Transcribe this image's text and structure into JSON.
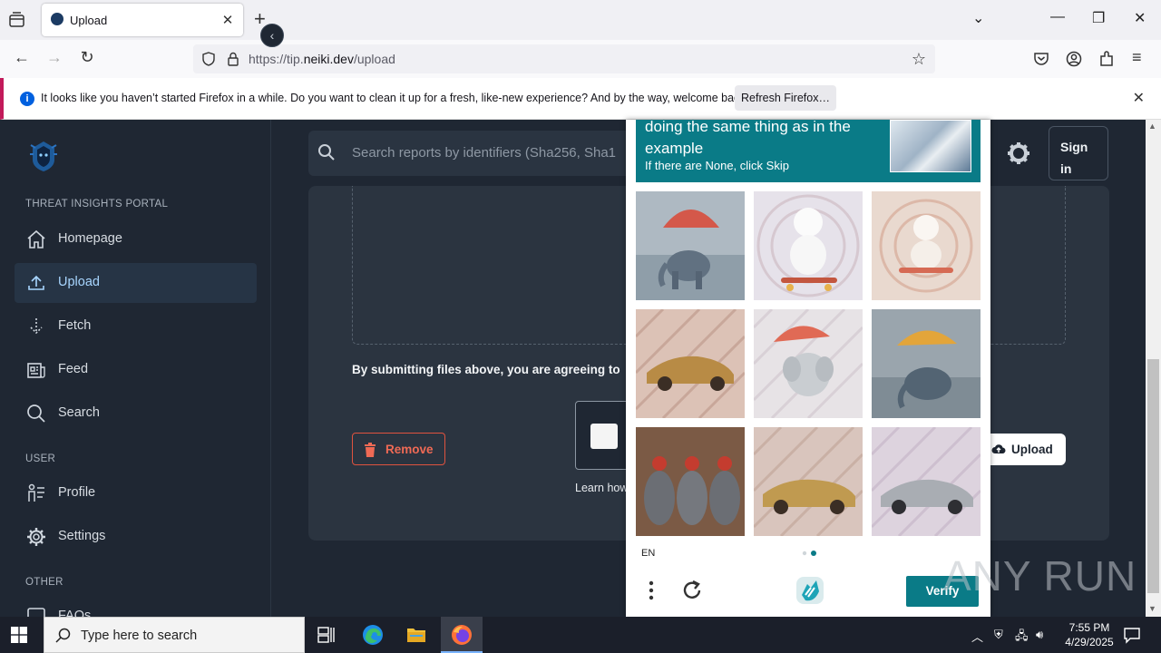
{
  "browser": {
    "tab_title": "Upload",
    "url_prefix": "https://tip.",
    "url_domain": "neiki.dev",
    "url_path": "/upload",
    "notification_message": "It looks like you haven’t started Firefox in a while. Do you want to clean it up for a fresh, like-new experience? And by the way, welcome back!",
    "refresh_label": "Refresh Firefox…"
  },
  "sidebar": {
    "portal_label": "THREAT INSIGHTS PORTAL",
    "items": [
      {
        "label": "Homepage",
        "icon": "home-icon"
      },
      {
        "label": "Upload",
        "icon": "upload-icon"
      },
      {
        "label": "Fetch",
        "icon": "fetch-icon"
      },
      {
        "label": "Feed",
        "icon": "feed-icon"
      },
      {
        "label": "Search",
        "icon": "search-icon"
      }
    ],
    "user_label": "USER",
    "user_items": [
      {
        "label": "Profile",
        "icon": "profile-icon"
      },
      {
        "label": "Settings",
        "icon": "settings-icon"
      }
    ],
    "other_label": "OTHER",
    "other_items": [
      {
        "label": "FAQs",
        "icon": "faq-icon"
      }
    ]
  },
  "header": {
    "search_placeholder": "Search reports by identifiers (Sha256, Sha1",
    "signin_line1": "Sign",
    "signin_line2": "in"
  },
  "upload": {
    "agreement_text": "By submitting files above, you are agreeing to",
    "remove_label": "Remove",
    "learn_text": "Learn how",
    "upload_label": "Upload"
  },
  "captcha": {
    "prompt_line1": "doing the same thing as in the",
    "prompt_line2": "example",
    "prompt_hint": "If there are None, click Skip",
    "tiles": [
      {
        "subject": "elephant with parachute in water"
      },
      {
        "subject": "white poodle on skateboard"
      },
      {
        "subject": "poodle on skateboard"
      },
      {
        "subject": "gold sports car"
      },
      {
        "subject": "elephant with umbrella"
      },
      {
        "subject": "elephant with umbrella in water"
      },
      {
        "subject": "chickens"
      },
      {
        "subject": "gold car"
      },
      {
        "subject": "silver sports car"
      }
    ],
    "language": "EN",
    "verify_label": "Verify",
    "page_indicator": {
      "pages": 2,
      "current": 2
    }
  },
  "watermark": "ANY RUN",
  "taskbar": {
    "search_placeholder": "Type here to search",
    "time": "7:55 PM",
    "date": "4/29/2025"
  }
}
